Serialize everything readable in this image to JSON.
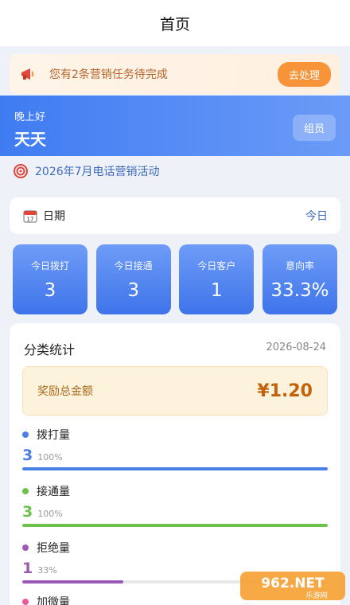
{
  "header": {
    "title": "首页"
  },
  "notice": {
    "icon": "megaphone-icon",
    "text": "您有2条营销任务待完成",
    "button": "去处理"
  },
  "greeting": {
    "salutation": "晚上好",
    "name": "天天",
    "role": "组员"
  },
  "campaign": {
    "icon": "target-icon",
    "text": "2026年7月电话营销活动"
  },
  "date": {
    "icon": "calendar-icon",
    "label": "日期",
    "value": "今日"
  },
  "stats": [
    {
      "label": "今日拨打",
      "value": "3"
    },
    {
      "label": "今日接通",
      "value": "3"
    },
    {
      "label": "今日客户",
      "value": "1"
    },
    {
      "label": "意向率",
      "value": "33.3%"
    }
  ],
  "category": {
    "title": "分类统计",
    "date": "2026-08-24",
    "reward_label": "奖励总金额",
    "reward_value": "¥1.20",
    "metrics": [
      {
        "name": "拨打量",
        "value": "3",
        "percent": "100%",
        "fraction": 1.0,
        "color": "#4a7fe6"
      },
      {
        "name": "接通量",
        "value": "3",
        "percent": "100%",
        "fraction": 1.0,
        "color": "#6cc24a"
      },
      {
        "name": "拒绝量",
        "value": "1",
        "percent": "33%",
        "fraction": 0.33,
        "color": "#9b59b6"
      },
      {
        "name": "加微量",
        "value": "",
        "percent": "",
        "fraction": 0,
        "color": "#e85a9a"
      }
    ]
  },
  "watermark": {
    "text": "962.NET",
    "subtext": "乐游网"
  }
}
